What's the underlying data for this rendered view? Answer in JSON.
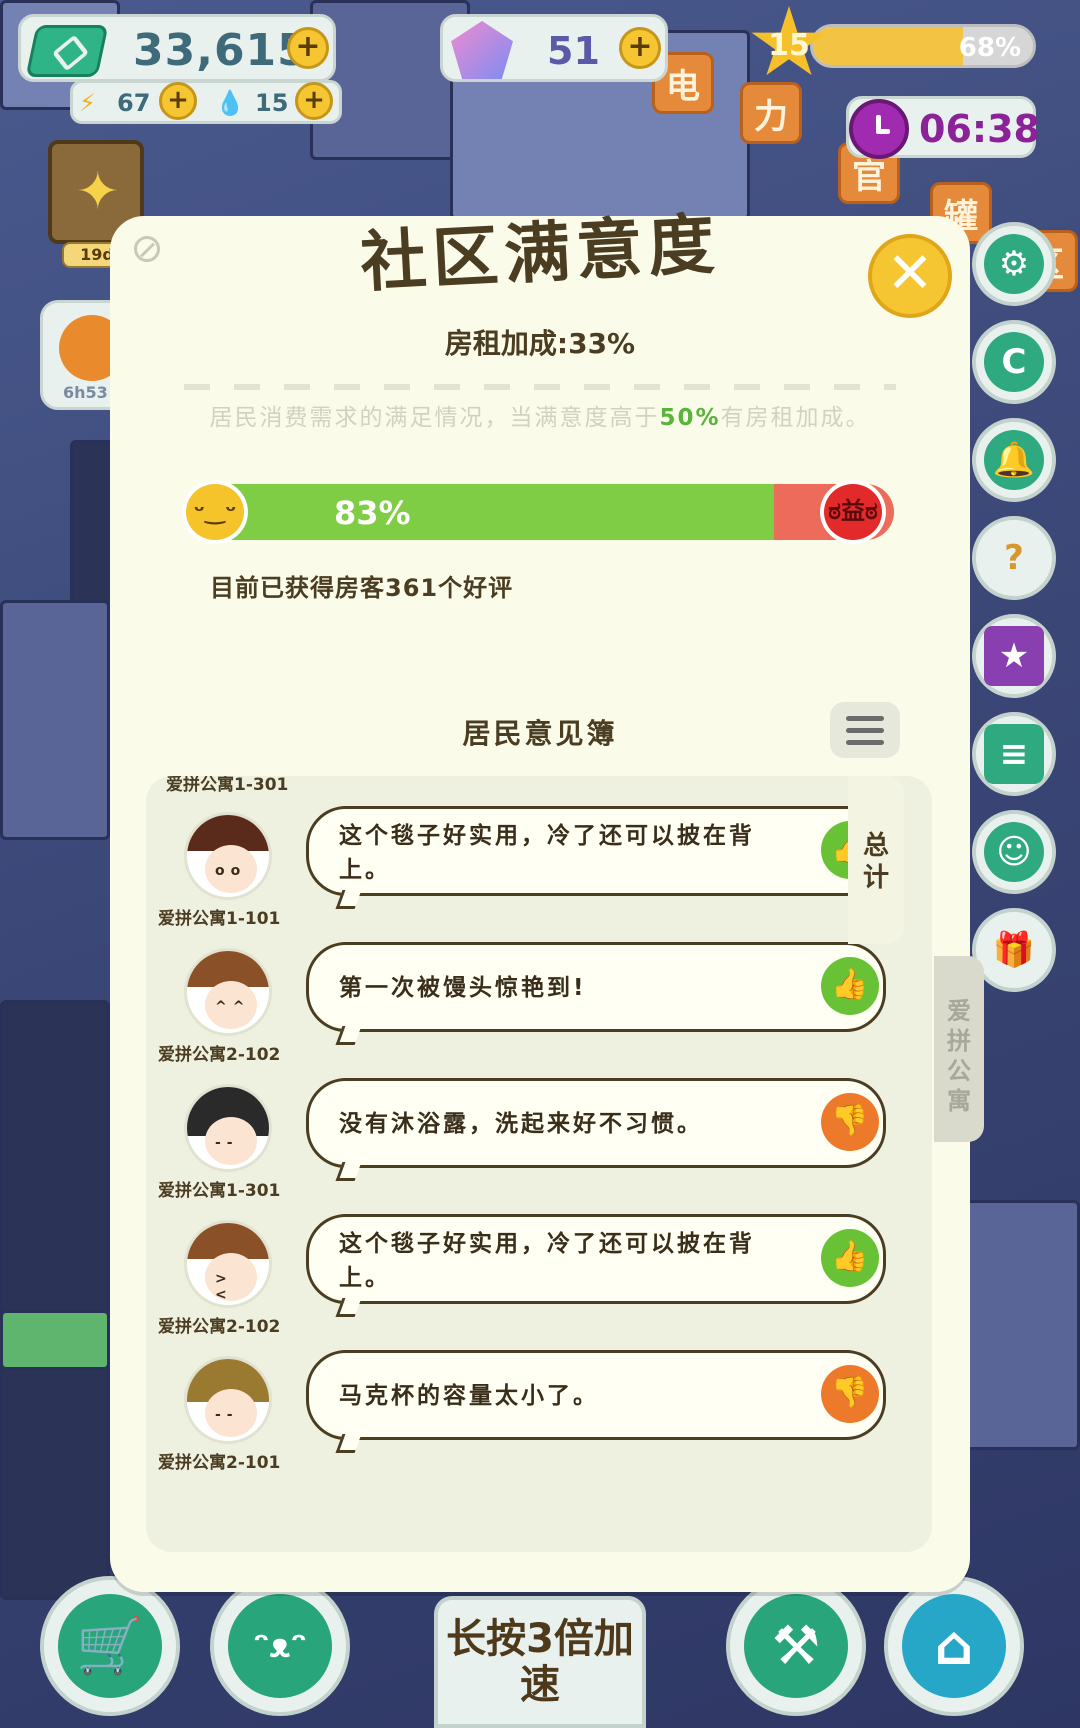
{
  "hud": {
    "money": "33,615",
    "energy": "67",
    "water": "15",
    "gems": "51",
    "level": "15",
    "level_progress": "68%",
    "level_progress_fraction": 0.68,
    "timer": "06:38",
    "plus": "+"
  },
  "left_side": {
    "book_tag": "19d",
    "house_tag": "6h53"
  },
  "panel": {
    "title": "社区满意度",
    "close": "✕",
    "bonus": "房租加成:33%",
    "desc_before": "居民消费需求的满足情况，当满意度高于",
    "desc_highlight": "50%",
    "desc_after": "有房租加成。",
    "satisfaction": "83%",
    "satisfaction_fraction": 0.83,
    "reviews": "目前已获得房客361个好评",
    "guestbook_title": "居民意见簿",
    "tab_total": "总计",
    "tab_apartment": "爱拼公寓",
    "happy_face": "ᵕ‿ᵕ",
    "angry_face": "ಠ益ಠ"
  },
  "feed": {
    "top_clip_name": "爱拼公寓1-301",
    "entries": [
      {
        "text": "这个毯子好实用，冷了还可以披在背上。",
        "name": "爱拼公寓1-101",
        "rating": "up",
        "icon": "👍"
      },
      {
        "text": "第一次被馒头惊艳到!",
        "name": "爱拼公寓2-102",
        "rating": "up",
        "icon": "👍"
      },
      {
        "text": "没有沐浴露，洗起来好不习惯。",
        "name": "爱拼公寓1-301",
        "rating": "down",
        "icon": "👎"
      },
      {
        "text": "这个毯子好实用，冷了还可以披在背上。",
        "name": "爱拼公寓2-102",
        "rating": "up",
        "icon": "👍"
      },
      {
        "text": "马克杯的容量太小了。",
        "name": "爱拼公寓2-101",
        "rating": "down",
        "icon": "👎"
      }
    ]
  },
  "bottom": {
    "speed_label": "长按3倍加速",
    "shop_icon": "🛒",
    "face_icon": "ᵔᴥᵔ",
    "tools_icon": "⚒",
    "home_icon": "⌂"
  },
  "right_buttons": [
    {
      "icon": "⚙",
      "name": "settings"
    },
    {
      "icon": "C",
      "name": "currency"
    },
    {
      "icon": "🔔",
      "name": "bell"
    },
    {
      "icon": "?",
      "name": "mystery-box"
    },
    {
      "icon": "★",
      "name": "star-book"
    },
    {
      "icon": "≡",
      "name": "notes"
    },
    {
      "icon": "☺",
      "name": "chat"
    },
    {
      "icon": "🎁",
      "name": "gift"
    }
  ],
  "signs": [
    "电",
    "力",
    "官",
    "罐",
    "区"
  ],
  "colors": {
    "accent_green": "#58b43a",
    "bar_good": "#7fcd44",
    "bar_bad": "#ec6b5a",
    "thumb_up": "#69c236",
    "thumb_down": "#ed7a2a"
  }
}
